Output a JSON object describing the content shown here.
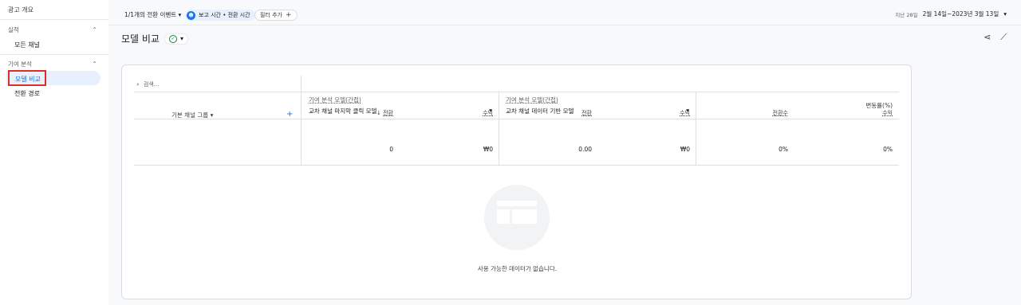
{
  "sidebar": {
    "top_item": "광고 개요",
    "groups": [
      {
        "label": "실적",
        "items": [
          "모든 채널"
        ]
      },
      {
        "label": "기여 분석",
        "items": [
          "모델 비교",
          "전환 경로"
        ]
      }
    ],
    "active_item": "모델 비교"
  },
  "topbar": {
    "conversion_selector": "1/1개의 전환 이벤트",
    "chip_label": "보고 시간 • 전환 시간",
    "chip_icon": "person-icon",
    "filter_label": "필터 추가",
    "date_prefix": "지난 28일",
    "date_range": "2월 14일~2023년 3월 13일"
  },
  "page": {
    "title": "모델 비교",
    "status": "ok"
  },
  "table": {
    "search_placeholder": "검색...",
    "dimension_label": "기본 채널 그룹",
    "model_1": {
      "heading": "기여 분석 모델(간접)",
      "value": "교차 채널 마지막 클릭 모델"
    },
    "model_2": {
      "heading": "기여 분석 모델(간접)",
      "value": "교차 채널 데이터 기반 모델"
    },
    "change_heading": "변동률(%)",
    "columns": {
      "m1_conv": "전환",
      "m1_rev": "수익",
      "m2_conv": "전환",
      "m2_rev": "수익",
      "chg_conv": "전환수",
      "chg_rev": "수익"
    },
    "totals": {
      "m1_conv": "0",
      "m1_rev": "₩0",
      "m2_conv": "0.00",
      "m2_rev": "₩0",
      "chg_conv": "0%",
      "chg_rev": "0%"
    },
    "sort_arrow": "↓"
  },
  "empty_message": "사용 가능한 데이터가 없습니다.",
  "colors": {
    "accent": "#1a73e8",
    "highlight": "#d93025",
    "ok": "#188038"
  }
}
